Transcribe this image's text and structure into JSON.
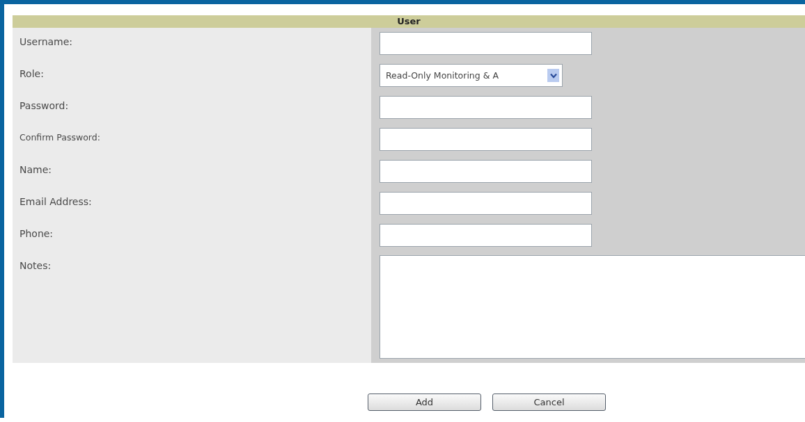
{
  "form": {
    "title": "User",
    "fields": [
      {
        "kind": "text",
        "label": "Username:"
      },
      {
        "kind": "select",
        "label": "Role:",
        "value": "Read-Only Monitoring & A"
      },
      {
        "kind": "text",
        "label": "Password:"
      },
      {
        "kind": "text",
        "label": "Confirm Password:",
        "small": true
      },
      {
        "kind": "text",
        "label": "Name:"
      },
      {
        "kind": "text",
        "label": "Email Address:"
      },
      {
        "kind": "text",
        "label": "Phone:"
      },
      {
        "kind": "textarea",
        "label": "Notes:"
      }
    ]
  },
  "buttons": [
    "Add",
    "Cancel"
  ]
}
